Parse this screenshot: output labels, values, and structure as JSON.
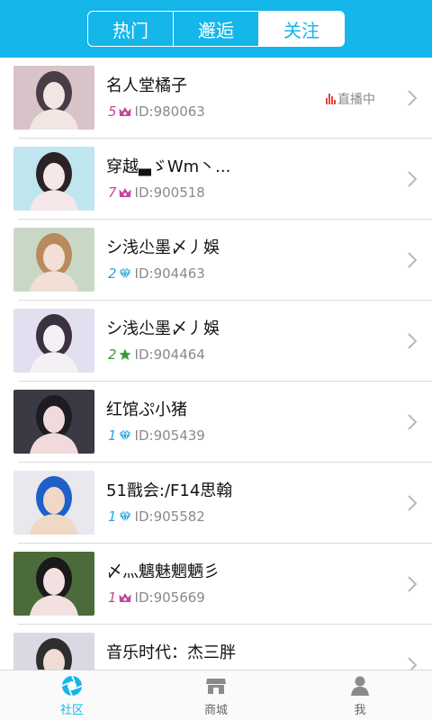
{
  "header": {
    "tabs": [
      {
        "label": "热门",
        "active": false
      },
      {
        "label": "邂逅",
        "active": false
      },
      {
        "label": "关注",
        "active": true
      }
    ]
  },
  "colors": {
    "accent": "#15b6ea",
    "crown": "#c8459a",
    "diamond": "#2aa6e0",
    "star": "#3d9b35",
    "live": "#e0473d"
  },
  "follow_list": [
    {
      "name": "名人堂橘子",
      "level": "5",
      "badge": "crown-icon",
      "id_text": "ID:980063",
      "live_text": "直播中",
      "avatar_colors": [
        "#d8c3c8",
        "#f2e6e2",
        "#4a3c46"
      ]
    },
    {
      "name": "穿越▃ゞWm丶...",
      "level": "7",
      "badge": "crown-icon",
      "id_text": "ID:900518",
      "live_text": "",
      "avatar_colors": [
        "#bfe6ef",
        "#f6e7e9",
        "#2a2226"
      ]
    },
    {
      "name": "シ浅尐墨〆丿娛",
      "level": "2",
      "badge": "diamond-icon",
      "id_text": "ID:904463",
      "live_text": "",
      "avatar_colors": [
        "#c9d8c6",
        "#f2e0d6",
        "#b98a5e"
      ]
    },
    {
      "name": "シ浅尐墨〆丿娛",
      "level": "2",
      "badge": "star-icon",
      "id_text": "ID:904464",
      "live_text": "",
      "avatar_colors": [
        "#e2dff0",
        "#f5f0f5",
        "#3a3240"
      ]
    },
    {
      "name": "红馆ぷ小猪",
      "level": "1",
      "badge": "diamond-icon",
      "id_text": "ID:905439",
      "live_text": "",
      "avatar_colors": [
        "#3a3a44",
        "#f0dadc",
        "#1c1c22"
      ]
    },
    {
      "name": "51戬会:/F14思翰",
      "level": "1",
      "badge": "diamond-icon",
      "id_text": "ID:905582",
      "live_text": "",
      "avatar_colors": [
        "#e8e8ee",
        "#f0d8c6",
        "#1e60c8"
      ]
    },
    {
      "name": "〆灬魑魅魍魉彡",
      "level": "1",
      "badge": "crown-icon",
      "id_text": "ID:905669",
      "live_text": "",
      "avatar_colors": [
        "#4c6b3a",
        "#f3e0e0",
        "#1a1a1a"
      ]
    },
    {
      "name": "音乐时代：杰三胖",
      "level": "",
      "badge": "",
      "id_text": "",
      "live_text": "",
      "avatar_colors": [
        "#d9d9e4",
        "#f0dcd2",
        "#2e2e2e"
      ]
    }
  ],
  "tabbar": [
    {
      "label": "社区",
      "icon": "community-icon",
      "active": true
    },
    {
      "label": "商城",
      "icon": "store-icon",
      "active": false
    },
    {
      "label": "我",
      "icon": "profile-icon",
      "active": false
    }
  ]
}
